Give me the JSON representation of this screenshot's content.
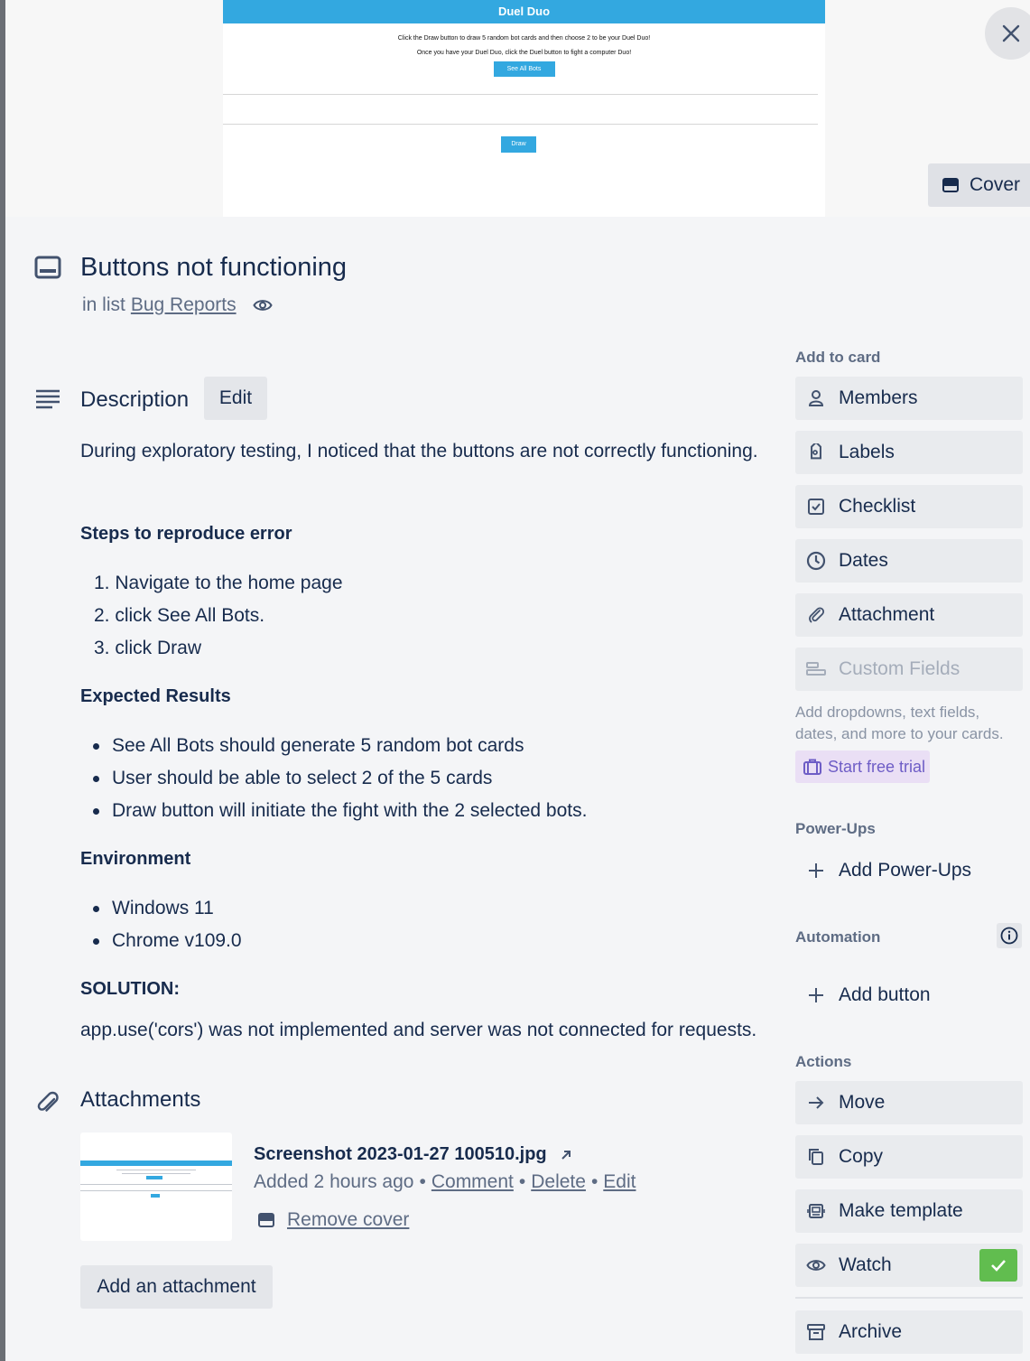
{
  "cover": {
    "app_title": "Duel Duo",
    "line1": "Click the Draw button to draw 5 random bot cards and then choose 2 to be your Duel Duo!",
    "line2": "Once you have your Duel Duo, click the Duel button to fight a computer Duo!",
    "see_all_bots": "See All Bots",
    "draw": "Draw",
    "cover_button": "Cover"
  },
  "card": {
    "title": "Buttons not functioning",
    "in_list_prefix": "in list",
    "list_name": "Bug Reports"
  },
  "description": {
    "heading": "Description",
    "edit_label": "Edit",
    "intro": "During exploratory testing, I noticed that the buttons are not correctly functioning.",
    "steps_heading": "Steps to reproduce error",
    "steps": [
      "1. Navigate to the home page",
      "2. click See All Bots.",
      "3. click Draw"
    ],
    "expected_heading": "Expected Results",
    "expected": [
      "See All Bots should generate 5 random bot cards",
      "User should be able to select 2 of the 5 cards",
      "Draw button will initiate the fight with the 2 selected bots."
    ],
    "env_heading": "Environment",
    "env": [
      "Windows 11",
      "Chrome v109.0"
    ],
    "solution_heading": "SOLUTION:",
    "solution": "app.use('cors') was not implemented and server was not connected for requests."
  },
  "attachments": {
    "heading": "Attachments",
    "file_name": "Screenshot 2023-01-27 100510.jpg",
    "added": "Added 2 hours ago",
    "sep": "•",
    "comment": "Comment",
    "delete": "Delete",
    "edit": "Edit",
    "remove_cover": "Remove cover",
    "add_button": "Add an attachment"
  },
  "sidebar": {
    "add_to_card": "Add to card",
    "members": "Members",
    "labels": "Labels",
    "checklist": "Checklist",
    "dates": "Dates",
    "attachment": "Attachment",
    "custom_fields": "Custom Fields",
    "custom_fields_note": "Add dropdowns, text fields, dates, and more to your cards.",
    "start_trial": "Start free trial",
    "power_ups_heading": "Power-Ups",
    "add_power_ups": "Add Power-Ups",
    "automation_heading": "Automation",
    "add_button": "Add button",
    "actions_heading": "Actions",
    "move": "Move",
    "copy": "Copy",
    "make_template": "Make template",
    "watch": "Watch",
    "archive": "Archive"
  },
  "colors": {
    "accent": "#33a8e0",
    "watch_check": "#61bd4f",
    "trial_bg": "#eadff5",
    "trial_text": "#6e5dc6"
  }
}
